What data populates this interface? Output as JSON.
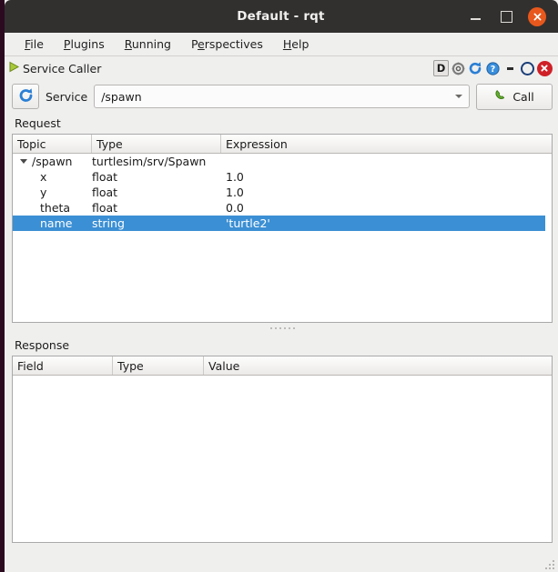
{
  "window": {
    "title": "Default - rqt",
    "minimize_label": "minimize",
    "maximize_label": "maximize",
    "close_label": "close"
  },
  "menubar": {
    "items": [
      {
        "label": "File",
        "pre": "",
        "acc": "F",
        "post": "ile"
      },
      {
        "label": "Plugins",
        "pre": "",
        "acc": "P",
        "post": "lugins"
      },
      {
        "label": "Running",
        "pre": "",
        "acc": "R",
        "post": "unning"
      },
      {
        "label": "Perspectives",
        "pre": "P",
        "acc": "e",
        "post": "rspectives"
      },
      {
        "label": "Help",
        "pre": "",
        "acc": "H",
        "post": "elp"
      }
    ]
  },
  "dock": {
    "title": "Service Caller",
    "play_icon": "play-triangle-icon",
    "buttons": [
      {
        "name": "dock-letter-button",
        "label": "D",
        "icon": "letter-d-icon"
      },
      {
        "name": "settings-button",
        "label": "",
        "icon": "gear-icon"
      },
      {
        "name": "reload-button",
        "label": "",
        "icon": "refresh-icon"
      },
      {
        "name": "help-button",
        "label": "",
        "icon": "question-mark-icon"
      }
    ],
    "window_buttons": [
      {
        "name": "dock-minimize-button",
        "icon": "dash-icon"
      },
      {
        "name": "dock-float-button",
        "icon": "circle-icon"
      },
      {
        "name": "dock-close-button",
        "icon": "close-x-icon"
      }
    ]
  },
  "service_row": {
    "refresh_icon": "refresh-icon",
    "label": "Service",
    "value": "/spawn",
    "placeholder": "",
    "dropdown_icon": "chevron-down-icon",
    "call_button": {
      "label": "Call",
      "icon": "phone-handset-icon"
    }
  },
  "request": {
    "section_label": "Request",
    "columns": [
      "Topic",
      "Type",
      "Expression"
    ],
    "rows": [
      {
        "topic": "/spawn",
        "type": "turtlesim/srv/Spawn",
        "expression": "",
        "level": 0,
        "expanded": true,
        "selected": false
      },
      {
        "topic": "x",
        "type": "float",
        "expression": "1.0",
        "level": 1,
        "expanded": false,
        "selected": false
      },
      {
        "topic": "y",
        "type": "float",
        "expression": "1.0",
        "level": 1,
        "expanded": false,
        "selected": false
      },
      {
        "topic": "theta",
        "type": "float",
        "expression": "0.0",
        "level": 1,
        "expanded": false,
        "selected": false
      },
      {
        "topic": "name",
        "type": "string",
        "expression": "'turtle2'",
        "level": 1,
        "expanded": false,
        "selected": true
      }
    ]
  },
  "response": {
    "section_label": "Response",
    "columns": [
      "Field",
      "Type",
      "Value"
    ],
    "rows": []
  },
  "colors": {
    "titlebar_bg": "#32302f",
    "close_button": "#e8581c",
    "window_bg": "#efefee",
    "selection_blue": "#3b8fd4",
    "accent_blue": "#2a7fd4",
    "call_green": "#4c9a2a",
    "dock_close_red": "#cf2027"
  }
}
